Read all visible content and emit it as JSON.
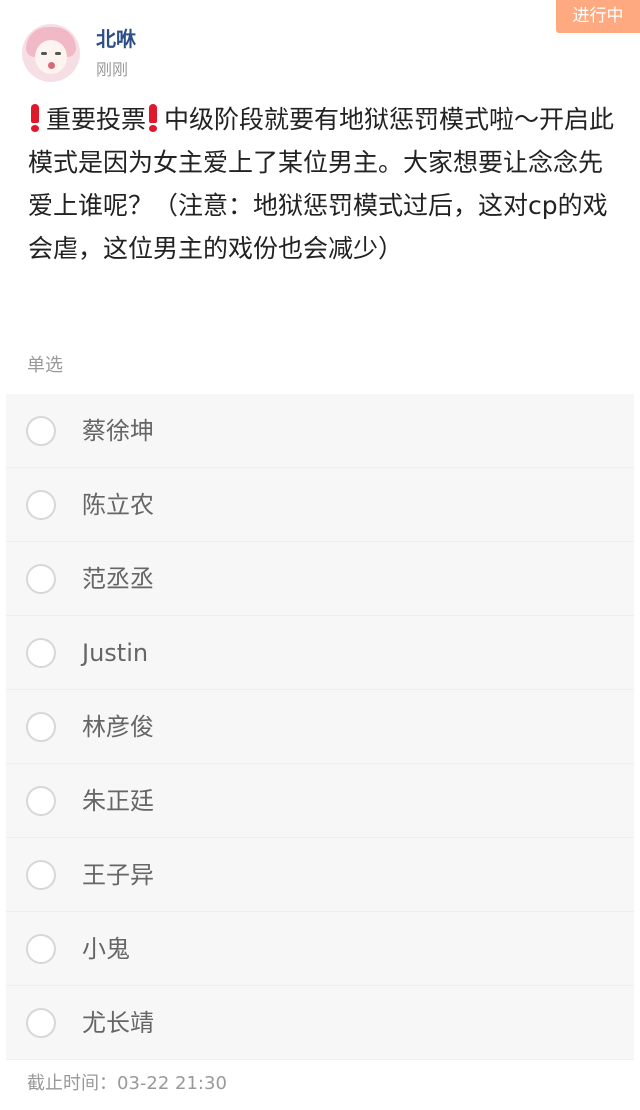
{
  "status_tag": "进行中",
  "user": {
    "name": "北咻",
    "time": "刚刚"
  },
  "post": {
    "alert_icon": "red-exclamation",
    "text_part1": "重要投票",
    "text_part2": "中级阶段就要有地狱惩罚模式啦～开启此模式是因为女主爱上了某位男主。大家想要让念念先爱上谁呢？（注意：地狱惩罚模式过后，这对cp的戏会虐，这位男主的戏份也会减少）"
  },
  "vote": {
    "type": "单选",
    "options": [
      {
        "label": "蔡徐坤"
      },
      {
        "label": "陈立农"
      },
      {
        "label": "范丞丞"
      },
      {
        "label": "Justin"
      },
      {
        "label": "林彦俊"
      },
      {
        "label": "朱正廷"
      },
      {
        "label": "王子异"
      },
      {
        "label": "小鬼"
      },
      {
        "label": "尤长靖"
      }
    ],
    "deadline": "截止时间：03-22 21:30"
  },
  "colors": {
    "status_tag_bg": "#ffa980",
    "username": "#2d4f86",
    "alert_icon": "#e0182c",
    "option_bg": "#f7f7f7"
  }
}
